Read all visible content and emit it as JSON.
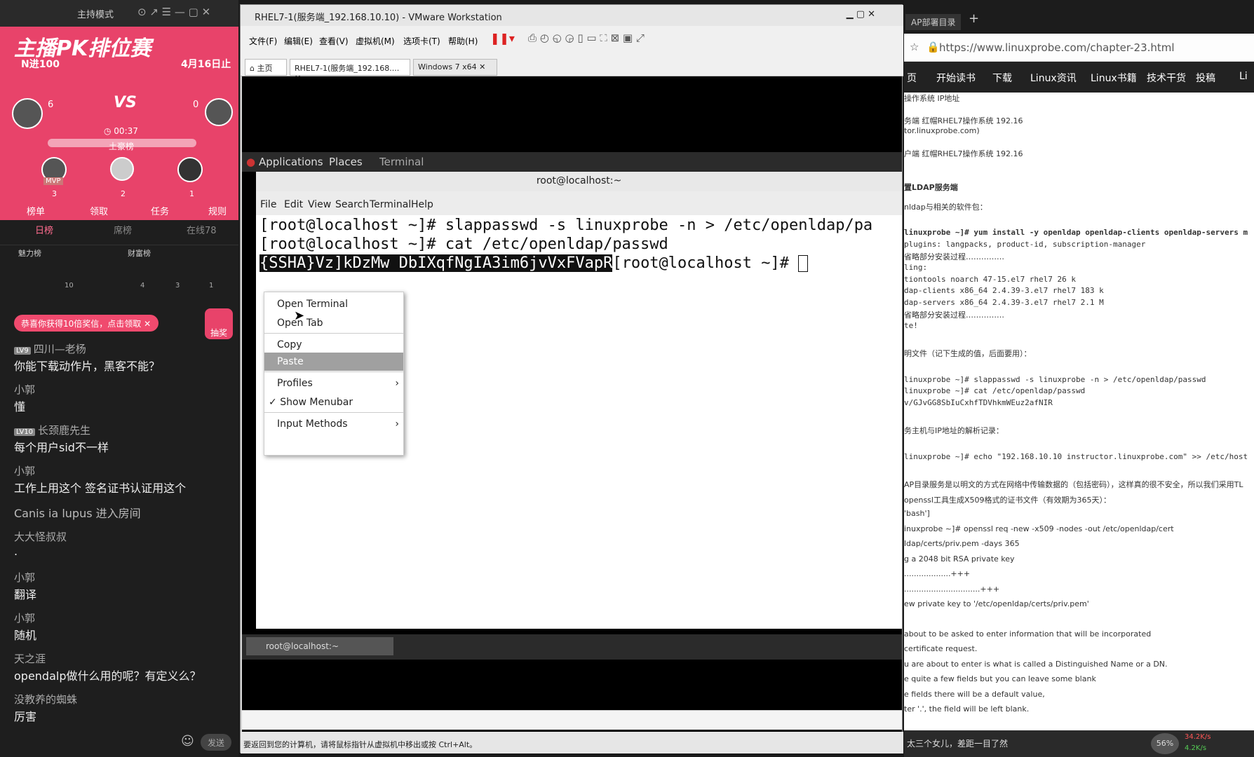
{
  "live": {
    "mode": "主持模式",
    "banner": "主播PK排位赛",
    "n_in": "N进100",
    "date_end": "4月16日止",
    "score_left": "6",
    "score_right": "0",
    "vs": "VS",
    "timer": "00:37",
    "rich_title": "土豪榜",
    "ranks": [
      "3",
      "2",
      "1"
    ],
    "mvp": "MVP",
    "actions": [
      "榜单",
      "领取",
      "任务",
      "规则"
    ],
    "tabs": [
      "日榜",
      "席榜",
      "在线78"
    ],
    "sub_left": "魅力榜",
    "sub_right": "财富榜",
    "sub_counts": [
      "10",
      "4",
      "3",
      "1"
    ],
    "gift": "恭喜你获得10倍奖信，点击领取",
    "lottery": "抽奖",
    "chat": [
      {
        "lv": "LV9",
        "name": "四川—老杨",
        "msg": "你能下载动作片，黑客不能？"
      },
      {
        "name": "小郭",
        "msg": "懂"
      },
      {
        "lv": "LV10",
        "name": "长颈鹿先生",
        "msg": "每个用户sid不一样"
      },
      {
        "name": "小郭",
        "msg": "工作上用这个 签名证书认证用这个"
      },
      {
        "name": "Canis ia lupus 进入房间",
        "msg": ""
      },
      {
        "name": "大大怪叔叔",
        "msg": "."
      },
      {
        "name": "小郭",
        "msg": "翻译"
      },
      {
        "name": "小郭",
        "msg": "随机"
      },
      {
        "name": "天之涯",
        "msg": "opendalp做什么用的呢？有定义么？"
      },
      {
        "name": "没教养的蜘蛛",
        "msg": "厉害"
      }
    ],
    "send": "发送"
  },
  "vm": {
    "title": "RHEL7-1(服务端_192.168.10.10) - VMware Workstation",
    "menu": [
      "文件(F)",
      "编辑(E)",
      "查看(V)",
      "虚拟机(M)",
      "选项卡(T)",
      "帮助(H)"
    ],
    "tabs": [
      "主页",
      "RHEL7-1(服务端_192.168....",
      "Windows 7 x64"
    ],
    "gnome": [
      "Applications",
      "Places",
      "Terminal"
    ],
    "term_title": "root@localhost:~",
    "term_menu": [
      "File",
      "Edit",
      "View",
      "Search",
      "Terminal",
      "Help"
    ],
    "lines": [
      "[root@localhost ~]# slappasswd -s linuxprobe -n > /etc/openldap/pa",
      "[root@localhost ~]# cat /etc/openldap/passwd"
    ],
    "line3_sel": "{SSHA}Vz]kDzMw DbIXqfNgIA3im6jvVxFVapR",
    "line3_prompt": "[root@localhost ~]# ",
    "ctx": [
      "Open Terminal",
      "Open Tab",
      "Copy",
      "Paste",
      "Profiles",
      "Show Menubar",
      "Input Methods"
    ],
    "task": "root@localhost:~",
    "status": "要返回到您的计算机，请将鼠标指针从虚拟机中移出或按 Ctrl+Alt。"
  },
  "browser": {
    "tab": "AP部署目录",
    "url": "https://www.linuxprobe.com/chapter-23.html",
    "nav": [
      "页",
      "开始读书",
      "下载",
      "Linux资讯",
      "Linux书籍",
      "技术干货",
      "投稿",
      "Li"
    ],
    "lines": [
      "操作系统                                  IP地址",
      "务端                                 红帽RHEL7操作系统                      192.16",
      "tor.linuxprobe.com)",
      "户端                                 红帽RHEL7操作系统                      192.16",
      "置LDAP服务端",
      "nldap与相关的软件包：",
      "linuxprobe ~]# yum install -y openldap openldap-clients openldap-servers m",
      "plugins: langpacks, product-id, subscription-manager",
      "省略部分安装过程……………",
      "ling:",
      "tiontools          noarch        47-15.el7          rhel7         26 k",
      "dap-clients        x86_64        2.4.39-3.el7       rhel7        183 k",
      "dap-servers        x86_64        2.4.39-3.el7       rhel7        2.1 M",
      "省略部分安装过程……………",
      "te!",
      "明文件（记下生成的值，后面要用）：",
      "linuxprobe ~]# slappasswd -s linuxprobe -n > /etc/openldap/passwd",
      "linuxprobe ~]# cat /etc/openldap/passwd",
      "v/GJvGG8SbIuCxhfTDVhkmWEuz2afNIR",
      "务主机与IP地址的解析记录：",
      "linuxprobe ~]# echo \"192.168.10.10 instructor.linuxprobe.com\" >> /etc/host",
      "AP目录服务是以明文的方式在网络中传输数据的（包括密码），这样真的很不安全，所以我们采用TL",
      "openssl工具生成X509格式的证书文件（有效期为365天）：",
      "'bash']",
      "inuxprobe   ~]#   openssl   req   -new   -x509   -nodes   -out   /etc/openldap/cert",
      "ldap/certs/priv.pem -days 365",
      "g a 2048 bit RSA private key",
      "...................+++",
      "...............................+++",
      "ew private key to '/etc/openldap/certs/priv.pem'",
      "about to be asked to enter information that will be incorporated",
      "certificate request.",
      "u are about to enter is what is called a Distinguished Name or a DN.",
      "e quite a few fields but you can leave some blank",
      "e fields there will be a default value,",
      "ter '.', the field will be left blank."
    ],
    "foot": "太三个女儿，差距一目了然",
    "speed_up": "34.2K/s",
    "speed_down": "4.2K/s",
    "pct": "56%"
  }
}
